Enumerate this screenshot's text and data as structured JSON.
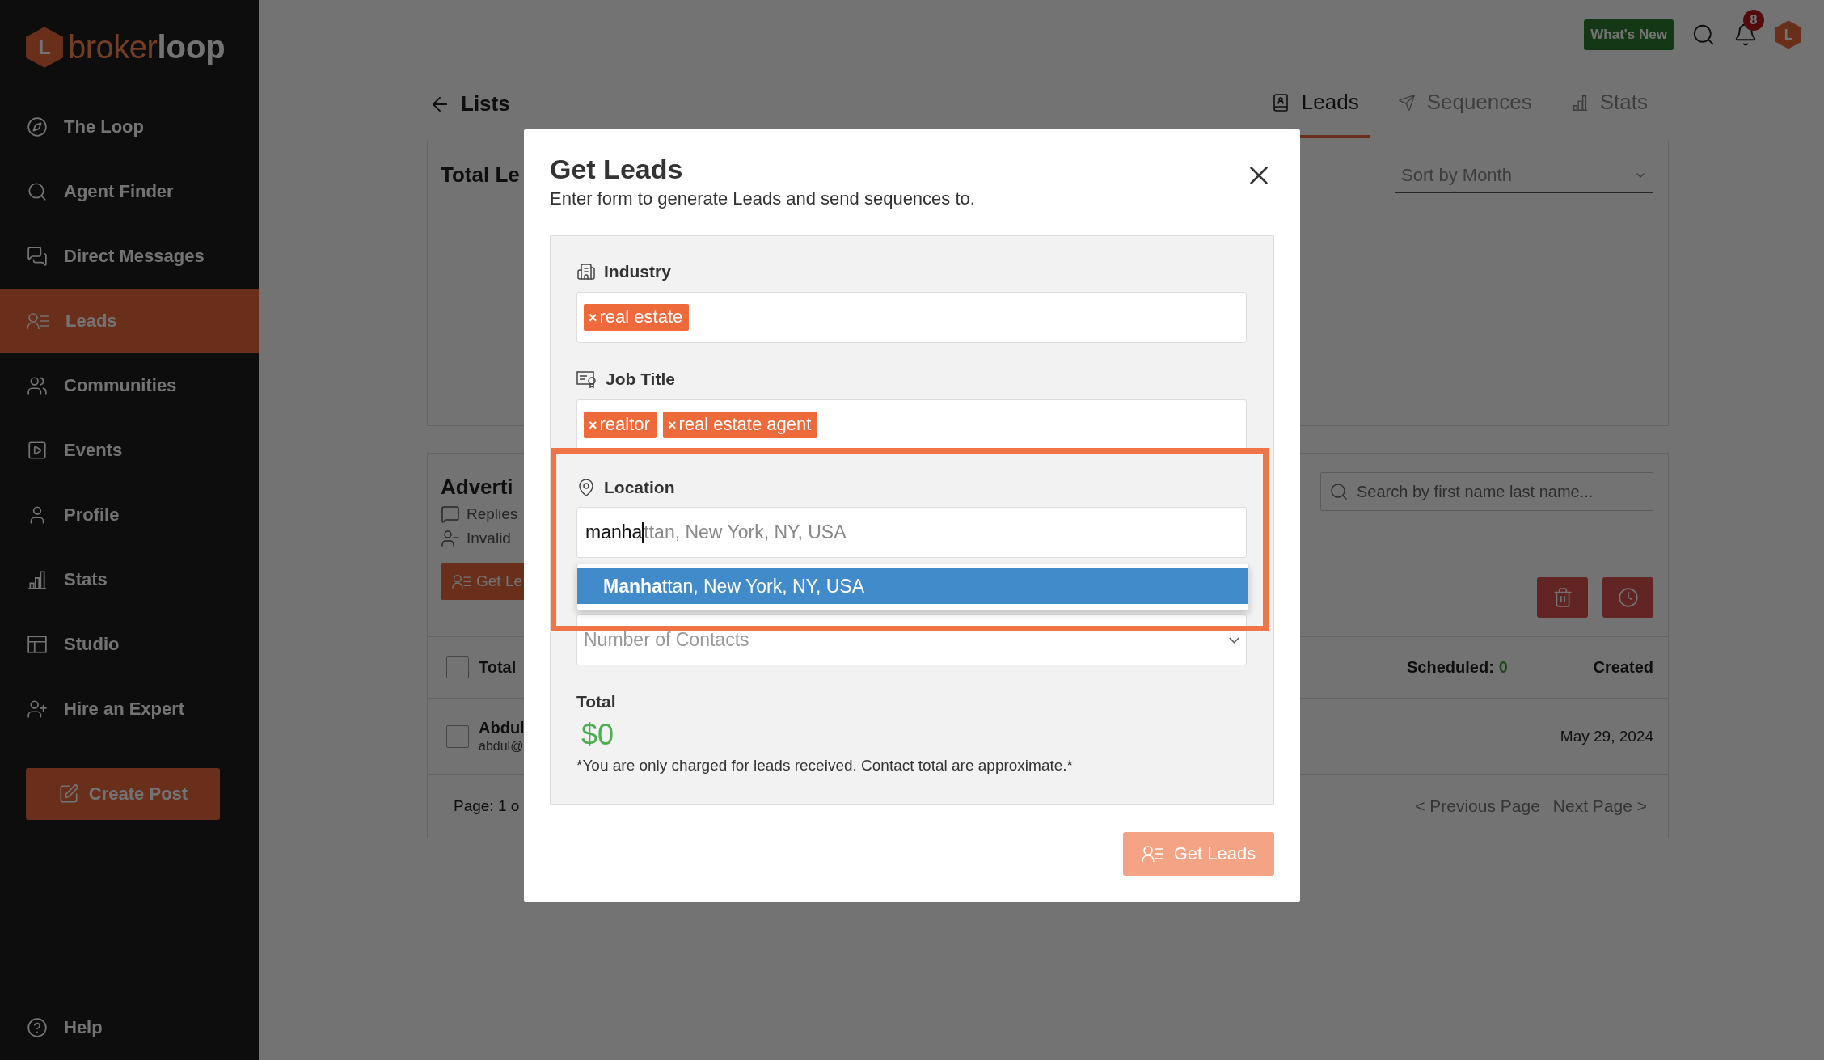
{
  "sidebar": {
    "logo": {
      "mark": "L",
      "part_1": "broker",
      "part_2": "loop"
    },
    "items": [
      {
        "kind": "compass",
        "label": "The Loop",
        "selected": false
      },
      {
        "kind": "search",
        "label": "Agent Finder",
        "selected": false
      },
      {
        "kind": "messages",
        "label": "Direct Messages",
        "selected": false
      },
      {
        "kind": "leads",
        "label": "Leads",
        "selected": true
      },
      {
        "kind": "users",
        "label": "Communities",
        "selected": false
      },
      {
        "kind": "play",
        "label": "Events",
        "selected": false
      },
      {
        "kind": "user",
        "label": "Profile",
        "selected": false
      },
      {
        "kind": "stats",
        "label": "Stats",
        "selected": false
      },
      {
        "kind": "studio",
        "label": "Studio",
        "selected": false
      },
      {
        "kind": "user-plus",
        "label": "Hire an Expert",
        "selected": false
      }
    ],
    "create_button": "Create Post",
    "help": "Help"
  },
  "top_bar": {
    "whats_new": "What's New",
    "notification_count": "8",
    "avatar_mark": "L"
  },
  "header": {
    "back_label": "Lists",
    "tabs": [
      {
        "kind": "leads",
        "label": "Leads",
        "selected": true
      },
      {
        "kind": "send",
        "label": "Sequences",
        "selected": false
      },
      {
        "kind": "stats",
        "label": "Stats",
        "selected": false
      }
    ]
  },
  "summary_card": {
    "title": "Total Le",
    "sort_select": "Sort by Month"
  },
  "list_card": {
    "title": "Adverti",
    "stats": [
      {
        "kind": "message",
        "label": "Replies"
      },
      {
        "kind": "user-minus",
        "label": "Invalid"
      }
    ],
    "get_leads_button": "Get Le",
    "search_placeholder": "Search by first name last name...",
    "header": {
      "checked": false,
      "total": "Total",
      "scheduled_label": "Scheduled:",
      "scheduled_value": "0",
      "created": "Created"
    },
    "rows": [
      {
        "name": "Abdul",
        "email": "abdul@",
        "date": "May 29, 2024",
        "checked": false
      }
    ],
    "pagination": {
      "page": "Page: 1 o",
      "previous": "< Previous Page",
      "next": "Next Page >"
    }
  },
  "modal": {
    "title": "Get Leads",
    "subtitle": "Enter form to generate Leads and send sequences to.",
    "fields": [
      {
        "kind": "tags",
        "label": "Industry",
        "tags": [
          {
            "remove": "×",
            "label": "real estate"
          }
        ]
      },
      {
        "kind": "tags",
        "label": "Job Title",
        "tags": [
          {
            "remove": "×",
            "label": "realtor"
          },
          {
            "remove": "×",
            "label": "real estate agent"
          }
        ]
      },
      {
        "kind": "autocomplete",
        "label": "Location",
        "typed": "manha",
        "completion": "ttan, New York, NY, USA",
        "highlighted": true,
        "options": [
          {
            "label": "**Manha**ttan, New York, NY, USA",
            "selected": true
          }
        ]
      },
      {
        "kind": "select",
        "placeholder": "Number of Contacts"
      }
    ],
    "total_label": "Total",
    "total": "$0",
    "note": "*You are only charged for leads received. Contact total are approximate.*",
    "submit": "Get Leads"
  }
}
